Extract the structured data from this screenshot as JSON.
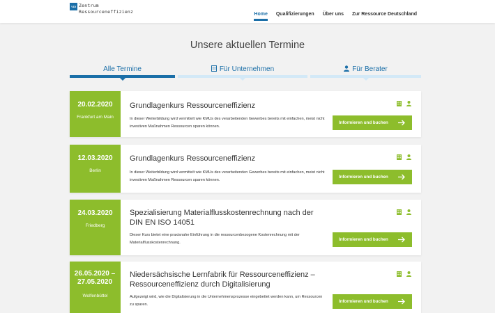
{
  "header": {
    "logo_badge": "VDI",
    "logo_line1": "Zentrum",
    "logo_line2": "Ressourceneffizienz",
    "nav": [
      {
        "label": "Home",
        "active": true
      },
      {
        "label": "Qualifizierungen",
        "active": false
      },
      {
        "label": "Über uns",
        "active": false
      },
      {
        "label": "Zur Ressource Deutschland",
        "active": false
      }
    ]
  },
  "page_title": "Unsere aktuellen Termine",
  "tabs": [
    {
      "label": "Alle Termine",
      "icon": "none",
      "active": true
    },
    {
      "label": "Für Unternehmen",
      "icon": "building-icon",
      "active": false
    },
    {
      "label": "Für Berater",
      "icon": "person-icon",
      "active": false
    }
  ],
  "events": [
    {
      "date": "20.02.2020",
      "city": "Frankfurt am Main",
      "title": "Grundlagenkurs Ressourceneffizienz",
      "description": "In dieser Weiterbildung wird vermittelt wie KMUs des verarbeitenden Gewerbes bereits mit einfachen, meist nicht investiven Maßnahmen Ressourcen sparen können.",
      "button": "Informieren und buchen"
    },
    {
      "date": "12.03.2020",
      "city": "Berlin",
      "title": "Grundlagenkurs Ressourceneffizienz",
      "description": "In dieser Weiterbildung wird vermittelt wie KMUs des verarbeitenden Gewerbes bereits mit einfachen, meist nicht investiven Maßnahmen Ressourcen sparen können.",
      "button": "Informieren und buchen"
    },
    {
      "date": "24.03.2020",
      "city": "Friedberg",
      "title": "Spezialisierung Materialflusskostenrechnung nach der DIN EN ISO 14051",
      "description": "Dieser Kurs bietet eine praxisnahe Einführung in die ressourcenbezogene Kostenrechnung mit der Materialflusskostenrechnung.",
      "button": "Informieren und buchen"
    },
    {
      "date": "26.05.2020 – 27.05.2020",
      "city": "Wolfenbüttel",
      "title": "Niedersächsische Lernfabrik für Ressourceneffizienz – Ressourceneffizienz durch Digitalisierung",
      "description": "Aufgezeigt wird, wie die Digitalisierung in die Unternehmensprozesse eingebettet werden kann, um Ressourcen zu sparen.",
      "button": "Informieren und buchen"
    }
  ],
  "colors": {
    "accent_blue": "#1b6fa8",
    "accent_green": "#8dbd2c",
    "tab_inactive": "#d3e9f7"
  }
}
